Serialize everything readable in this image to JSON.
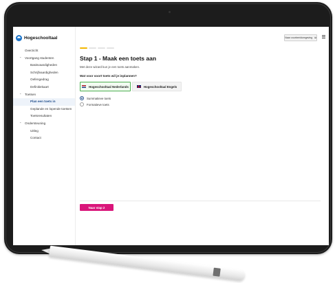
{
  "app": {
    "logo_text": "Hogeschooltaal"
  },
  "sidebar": {
    "items": [
      {
        "label": "Overzicht",
        "kind": "top"
      },
      {
        "label": "Voortgang studenten",
        "kind": "section"
      },
      {
        "label": "Basisvaardigheden",
        "kind": "sub"
      },
      {
        "label": "Schrijfvaardigheden",
        "kind": "sub"
      },
      {
        "label": "Oefengedrag",
        "kind": "sub"
      },
      {
        "label": "Definitiekaart",
        "kind": "sub"
      },
      {
        "label": "Toetsen",
        "kind": "section"
      },
      {
        "label": "Plan een toets in",
        "kind": "sub",
        "active": true
      },
      {
        "label": "Geplande en lopende toetsen",
        "kind": "sub"
      },
      {
        "label": "Toetsresultaten",
        "kind": "sub"
      },
      {
        "label": "Ondersteuning",
        "kind": "section"
      },
      {
        "label": "Uitleg",
        "kind": "sub"
      },
      {
        "label": "Contact",
        "kind": "sub"
      }
    ]
  },
  "topbar": {
    "button_label": "Naar voorbeeldomgeving",
    "menu_icon": "hamburger-icon"
  },
  "wizard": {
    "steps_total": 4,
    "steps_done": 1,
    "title": "Stap 1 - Maak een toets aan",
    "subtitle": "Met deze wizard kun je een toets aanmaken.",
    "question": "Wat voor soort toets wil je inplannen?",
    "options": [
      {
        "label": "Hogeschooltaal Nederlands",
        "selected": true,
        "flag": "nl-flag"
      },
      {
        "label": "Hogeschooltaal Engels",
        "selected": false,
        "flag": "uk-flag"
      }
    ],
    "test_types": [
      {
        "label": "Summatieve toets",
        "checked": true
      },
      {
        "label": "Formatieve toets",
        "checked": false
      }
    ],
    "next_label": "Naar stap 2"
  },
  "colors": {
    "accent": "#d9157a",
    "progress": "#f3b700",
    "selected_border": "#4caf50",
    "brand_blue": "#1a73c9"
  }
}
